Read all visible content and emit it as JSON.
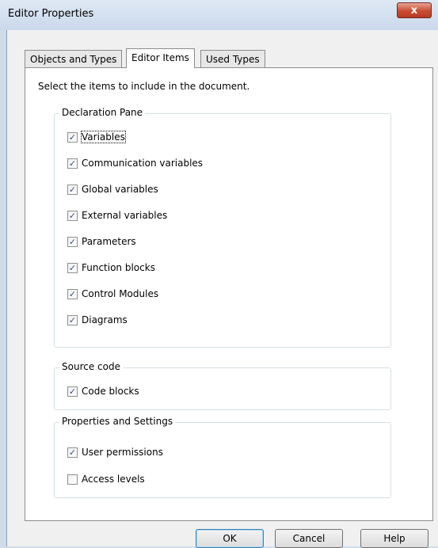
{
  "window": {
    "title": "Editor Properties",
    "close_glyph": "x"
  },
  "tabs": [
    {
      "label": "Objects and Types",
      "active": false
    },
    {
      "label": "Editor Items",
      "active": true
    },
    {
      "label": "Used Types",
      "active": false
    }
  ],
  "instruction": "Select the items to include in the document.",
  "groups": {
    "declaration": {
      "title": "Declaration Pane",
      "items": [
        {
          "label": "Variables",
          "checked": true
        },
        {
          "label": "Communication variables",
          "checked": true
        },
        {
          "label": "Global variables",
          "checked": true
        },
        {
          "label": "External variables",
          "checked": true
        },
        {
          "label": "Parameters",
          "checked": true
        },
        {
          "label": "Function blocks",
          "checked": true
        },
        {
          "label": "Control Modules",
          "checked": true
        },
        {
          "label": "Diagrams",
          "checked": true
        }
      ]
    },
    "source": {
      "title": "Source code",
      "items": [
        {
          "label": "Code blocks",
          "checked": true
        }
      ]
    },
    "properties": {
      "title": "Properties and Settings",
      "items": [
        {
          "label": "User permissions",
          "checked": true
        },
        {
          "label": "Access levels",
          "checked": false
        }
      ]
    }
  },
  "buttons": {
    "ok": "OK",
    "cancel": "Cancel",
    "help": "Help"
  },
  "check_glyph": "✓"
}
